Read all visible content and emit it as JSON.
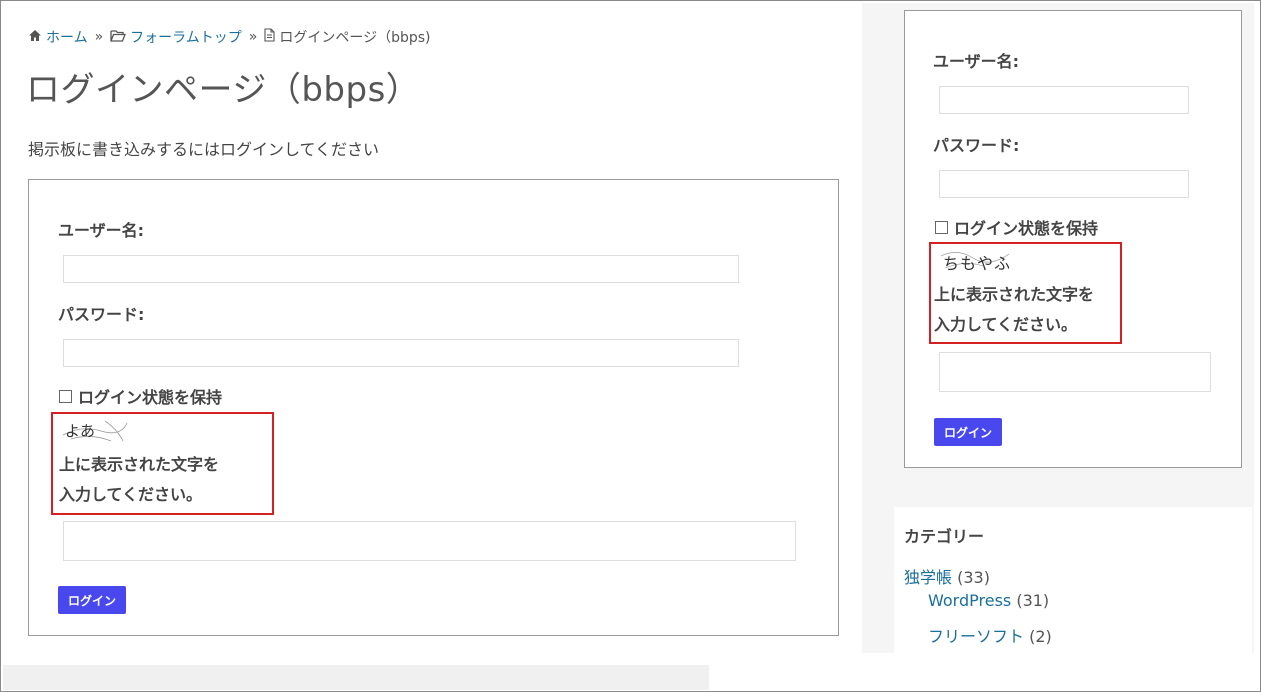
{
  "breadcrumb": {
    "home": "ホーム",
    "sep1": "»",
    "forum": "フォーラムトップ",
    "sep2": "»",
    "current": "ログインページ（bbps)"
  },
  "page": {
    "title": "ログインページ（bbps）",
    "intro": "掲示板に書き込みするにはログインしてください"
  },
  "main_form": {
    "username_label": "ユーザー名:",
    "username_value": "",
    "password_label": "パスワード:",
    "password_value": "",
    "remember_label": "ログイン状態を保持",
    "remember_checked": false,
    "captcha_image_text": "よあ",
    "captcha_prompt_line1": "上に表示された文字を",
    "captcha_prompt_line2": "入力してください。",
    "captcha_value": "",
    "submit_label": "ログイン"
  },
  "sidebar_form": {
    "username_label": "ユーザー名:",
    "password_label": "パスワード:",
    "remember_label": "ログイン状態を保持",
    "remember_checked": false,
    "captcha_image_text": "ちもやふ",
    "captcha_prompt_line1": "上に表示された文字を",
    "captcha_prompt_line2": "入力してください。",
    "submit_label": "ログイン"
  },
  "categories": {
    "title": "カテゴリー",
    "items": [
      {
        "label": "独学帳",
        "count": "(33)"
      },
      {
        "label": "WordPress",
        "count": "(31)"
      },
      {
        "label": "フリーソフト",
        "count": "(2)"
      }
    ]
  },
  "colors": {
    "link": "#1b6f9c",
    "button": "#4848ee",
    "highlight_border": "#d42020"
  }
}
